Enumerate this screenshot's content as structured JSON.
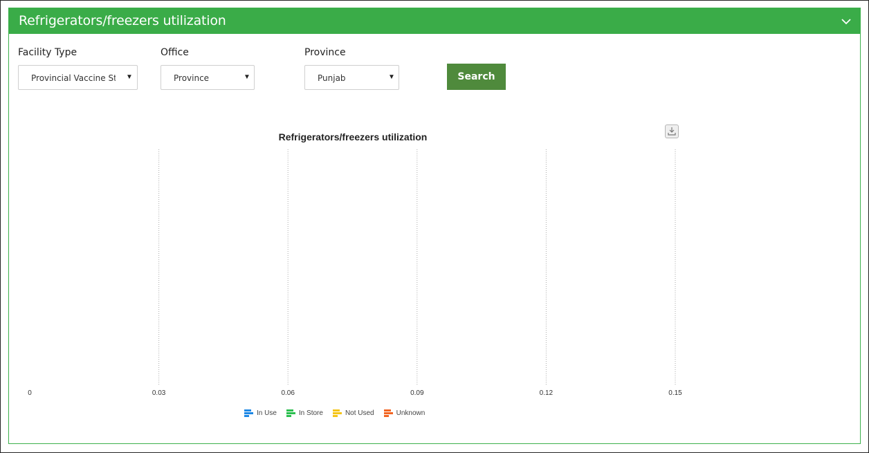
{
  "panel": {
    "title": "Refrigerators/freezers utilization"
  },
  "filters": {
    "facility_type": {
      "label": "Facility Type",
      "value": "Provincial Vaccine Store"
    },
    "office": {
      "label": "Office",
      "value": "Province"
    },
    "province": {
      "label": "Province",
      "value": "Punjab"
    }
  },
  "search_button": {
    "label": "Search"
  },
  "chart_data": {
    "type": "bar",
    "orientation": "horizontal",
    "title": "Refrigerators/freezers utilization",
    "categories": [],
    "series": [
      {
        "name": "In Use",
        "color": "#1e88e5",
        "values": []
      },
      {
        "name": "In Store",
        "color": "#2bbf4f",
        "values": []
      },
      {
        "name": "Not Used",
        "color": "#f5c518",
        "values": []
      },
      {
        "name": "Unknown",
        "color": "#f26522",
        "values": []
      }
    ],
    "x_ticks": [
      "0",
      "0.03",
      "0.06",
      "0.09",
      "0.12",
      "0.15"
    ],
    "xlim": [
      0,
      0.15
    ],
    "grid": true,
    "legend_position": "bottom"
  }
}
